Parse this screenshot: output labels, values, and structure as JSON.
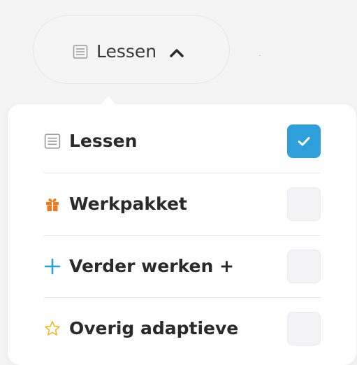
{
  "trigger": {
    "icon": "list-document-icon",
    "label": "Lessen",
    "chevron": "chevron-up-icon"
  },
  "dropdown": {
    "items": [
      {
        "label": "Lessen",
        "icon": "list-document-icon",
        "checked": true
      },
      {
        "label": "Werkpakket",
        "icon": "gift-icon",
        "checked": false
      },
      {
        "label": "Verder werken +",
        "icon": "plus-icon",
        "checked": false
      },
      {
        "label": "Overig adaptieve",
        "icon": "star-icon",
        "checked": false
      }
    ]
  },
  "colors": {
    "checkbox_checked": "#2f9fdc",
    "plus_icon": "#2f9fdc",
    "gift_icon": "#f07a1a",
    "star_icon": "#f3b81a"
  }
}
